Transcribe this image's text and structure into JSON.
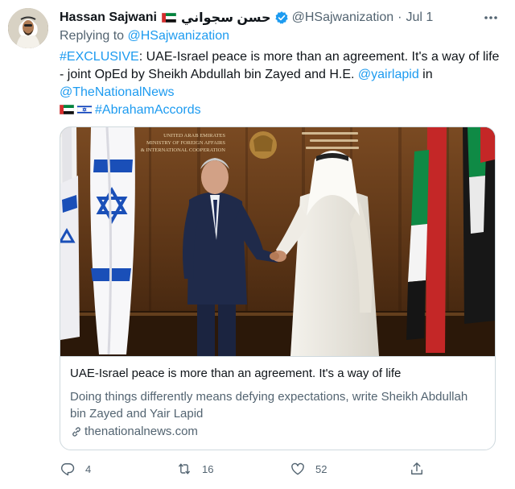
{
  "tweet": {
    "author_name": "Hassan Sajwani",
    "author_name_ar": "حسن سجواني",
    "handle": "@HSajwanization",
    "dot": "·",
    "date": "Jul 1",
    "replying_prefix": "Replying to",
    "replying_handle": "@HSajwanization",
    "text": {
      "hashtag_exclusive": "#EXCLUSIVE",
      "body_1": ": UAE-Israel peace is more than an agreement. It's a way of life - joint OpEd by Sheikh Abdullah bin Zayed and H.E. ",
      "mention_lapid": "@yairlapid",
      "body_2": " in",
      "mention_news": "@TheNationalNews",
      "hashtag_abraham": "#AbrahamAccords"
    }
  },
  "card": {
    "image_text": {
      "line1": "UNITED ARAB EMIRATES",
      "line2": "MINISTRY OF FOREIGN AFFAIRS",
      "line3": "& INTERNATIONAL COOPERATION"
    },
    "title": "UAE-Israel peace is more than an agreement. It's a way of life",
    "description": "Doing things differently means defying expectations, write Sheikh Abdullah bin Zayed and Yair Lapid",
    "domain": "thenationalnews.com"
  },
  "actions": {
    "replies": "4",
    "retweets": "16",
    "likes": "52"
  },
  "colors": {
    "link": "#1d9bf0",
    "secondary": "#536471",
    "uae_red": "#d62d2d",
    "uae_green": "#00843d",
    "israel_blue": "#0038b8"
  },
  "icons": [
    "verified-icon",
    "more-icon",
    "link-icon",
    "reply-icon",
    "retweet-icon",
    "like-icon",
    "share-icon",
    "uae-flag-icon",
    "israel-flag-icon"
  ]
}
